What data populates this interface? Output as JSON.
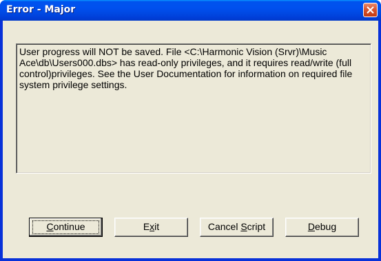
{
  "window": {
    "title": "Error - Major",
    "close_icon": "close-icon"
  },
  "message": {
    "text": "User progress will NOT be saved. File <C:\\Harmonic Vision (Srvr)\\Music Ace\\db\\Users000.dbs> has read-only privileges, and it requires read/write (full control)privileges. See the User Documentation for information on required file system privilege settings."
  },
  "buttons": {
    "continue": {
      "pre": "",
      "mnemonic": "C",
      "post": "ontinue"
    },
    "exit": {
      "pre": "E",
      "mnemonic": "x",
      "post": "it"
    },
    "cancel_script": {
      "pre": "Cancel ",
      "mnemonic": "S",
      "post": "cript"
    },
    "debug": {
      "pre": "",
      "mnemonic": "D",
      "post": "ebug"
    }
  },
  "colors": {
    "title_bar": "#0053ee",
    "dialog_face": "#ece9d8",
    "close_button": "#d8542f"
  }
}
